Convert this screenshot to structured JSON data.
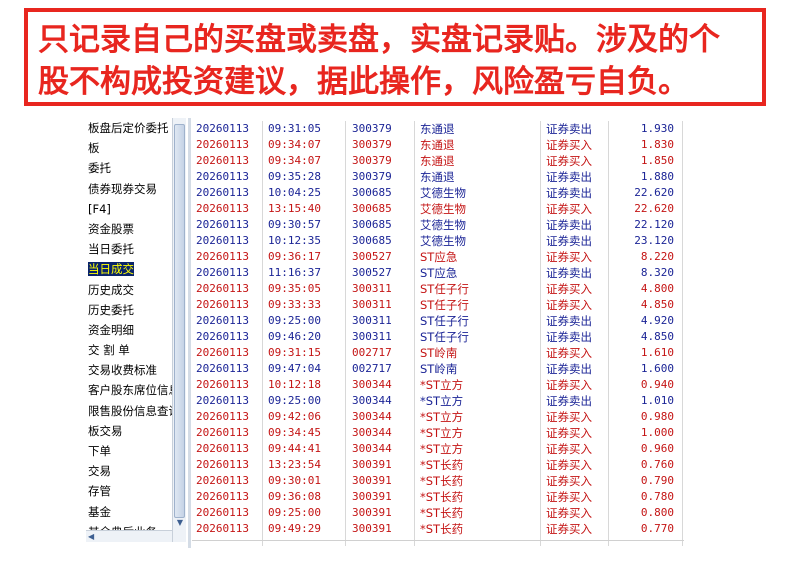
{
  "banner": {
    "line1": "只记录自己的买盘或卖盘，实盘记录贴。涉及的个",
    "line2": "股不构成投资建议，据此操作，风险盈亏自负。"
  },
  "sidebar": {
    "items": [
      {
        "label": "板盘后定价委托"
      },
      {
        "label": "板"
      },
      {
        "label": "委托"
      },
      {
        "label": "债券现券交易"
      },
      {
        "label": "[F4]"
      },
      {
        "label": "资金股票"
      },
      {
        "label": "当日委托"
      },
      {
        "label": "当日成交",
        "selected": true
      },
      {
        "label": "历史成交"
      },
      {
        "label": "历史委托"
      },
      {
        "label": "资金明细"
      },
      {
        "label": "交 割 单"
      },
      {
        "label": "交易收费标准"
      },
      {
        "label": "客户股东席位信息"
      },
      {
        "label": "限售股份信息查询"
      },
      {
        "label": "板交易"
      },
      {
        "label": "下单"
      },
      {
        "label": "交易"
      },
      {
        "label": "存管"
      },
      {
        "label": "基金"
      },
      {
        "label": "其余典后业务"
      }
    ]
  },
  "colors": {
    "sell": "#1b2496",
    "buy": "#c41414",
    "banner": "#e8261f",
    "selected_bg": "#0a246a",
    "selected_fg": "#ffff00"
  },
  "trades": [
    {
      "date": "20260113",
      "time": "09:31:05",
      "code": "300379",
      "name": "东通退",
      "type": "证券卖出",
      "price": "1.930",
      "side": "sell"
    },
    {
      "date": "20260113",
      "time": "09:34:07",
      "code": "300379",
      "name": "东通退",
      "type": "证券买入",
      "price": "1.830",
      "side": "buy"
    },
    {
      "date": "20260113",
      "time": "09:34:07",
      "code": "300379",
      "name": "东通退",
      "type": "证券买入",
      "price": "1.850",
      "side": "buy"
    },
    {
      "date": "20260113",
      "time": "09:35:28",
      "code": "300379",
      "name": "东通退",
      "type": "证券卖出",
      "price": "1.880",
      "side": "sell"
    },
    {
      "date": "20260113",
      "time": "10:04:25",
      "code": "300685",
      "name": "艾德生物",
      "type": "证券卖出",
      "price": "22.620",
      "side": "sell"
    },
    {
      "date": "20260113",
      "time": "13:15:40",
      "code": "300685",
      "name": "艾德生物",
      "type": "证券买入",
      "price": "22.620",
      "side": "buy"
    },
    {
      "date": "20260113",
      "time": "09:30:57",
      "code": "300685",
      "name": "艾德生物",
      "type": "证券卖出",
      "price": "22.120",
      "side": "sell"
    },
    {
      "date": "20260113",
      "time": "10:12:35",
      "code": "300685",
      "name": "艾德生物",
      "type": "证券卖出",
      "price": "23.120",
      "side": "sell"
    },
    {
      "date": "20260113",
      "time": "09:36:17",
      "code": "300527",
      "name": "ST应急",
      "type": "证券买入",
      "price": "8.220",
      "side": "buy"
    },
    {
      "date": "20260113",
      "time": "11:16:37",
      "code": "300527",
      "name": "ST应急",
      "type": "证券卖出",
      "price": "8.320",
      "side": "sell"
    },
    {
      "date": "20260113",
      "time": "09:35:05",
      "code": "300311",
      "name": "ST任子行",
      "type": "证券买入",
      "price": "4.800",
      "side": "buy"
    },
    {
      "date": "20260113",
      "time": "09:33:33",
      "code": "300311",
      "name": "ST任子行",
      "type": "证券买入",
      "price": "4.850",
      "side": "buy"
    },
    {
      "date": "20260113",
      "time": "09:25:00",
      "code": "300311",
      "name": "ST任子行",
      "type": "证券卖出",
      "price": "4.920",
      "side": "sell"
    },
    {
      "date": "20260113",
      "time": "09:46:20",
      "code": "300311",
      "name": "ST任子行",
      "type": "证券卖出",
      "price": "4.850",
      "side": "sell"
    },
    {
      "date": "20260113",
      "time": "09:31:15",
      "code": "002717",
      "name": "ST岭南",
      "type": "证券买入",
      "price": "1.610",
      "side": "buy"
    },
    {
      "date": "20260113",
      "time": "09:47:04",
      "code": "002717",
      "name": "ST岭南",
      "type": "证券卖出",
      "price": "1.600",
      "side": "sell"
    },
    {
      "date": "20260113",
      "time": "10:12:18",
      "code": "300344",
      "name": "*ST立方",
      "type": "证券买入",
      "price": "0.940",
      "side": "buy"
    },
    {
      "date": "20260113",
      "time": "09:25:00",
      "code": "300344",
      "name": "*ST立方",
      "type": "证券卖出",
      "price": "1.010",
      "side": "sell"
    },
    {
      "date": "20260113",
      "time": "09:42:06",
      "code": "300344",
      "name": "*ST立方",
      "type": "证券买入",
      "price": "0.980",
      "side": "buy"
    },
    {
      "date": "20260113",
      "time": "09:34:45",
      "code": "300344",
      "name": "*ST立方",
      "type": "证券买入",
      "price": "1.000",
      "side": "buy"
    },
    {
      "date": "20260113",
      "time": "09:44:41",
      "code": "300344",
      "name": "*ST立方",
      "type": "证券买入",
      "price": "0.960",
      "side": "buy"
    },
    {
      "date": "20260113",
      "time": "13:23:54",
      "code": "300391",
      "name": "*ST长药",
      "type": "证券买入",
      "price": "0.760",
      "side": "buy"
    },
    {
      "date": "20260113",
      "time": "09:30:01",
      "code": "300391",
      "name": "*ST长药",
      "type": "证券买入",
      "price": "0.790",
      "side": "buy"
    },
    {
      "date": "20260113",
      "time": "09:36:08",
      "code": "300391",
      "name": "*ST长药",
      "type": "证券买入",
      "price": "0.780",
      "side": "buy"
    },
    {
      "date": "20260113",
      "time": "09:25:00",
      "code": "300391",
      "name": "*ST长药",
      "type": "证券买入",
      "price": "0.800",
      "side": "buy"
    },
    {
      "date": "20260113",
      "time": "09:49:29",
      "code": "300391",
      "name": "*ST长药",
      "type": "证券买入",
      "price": "0.770",
      "side": "buy"
    }
  ]
}
